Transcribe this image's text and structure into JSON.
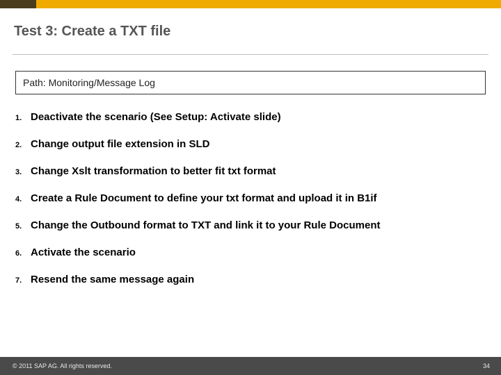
{
  "title": "Test 3: Create a TXT file",
  "path_box": "Path:  Monitoring/Message Log",
  "steps": [
    "Deactivate the scenario (See Setup: Activate slide)",
    "Change output file extension in SLD",
    "Change Xslt transformation to better fit txt format",
    "Create a Rule Document to define your txt format and upload it in B1if",
    "Change the Outbound format to TXT and link it to your Rule Document",
    "Activate the scenario",
    "Resend the same message again"
  ],
  "footer": {
    "copyright": "© 2011 SAP AG. All rights reserved.",
    "page": "34"
  }
}
